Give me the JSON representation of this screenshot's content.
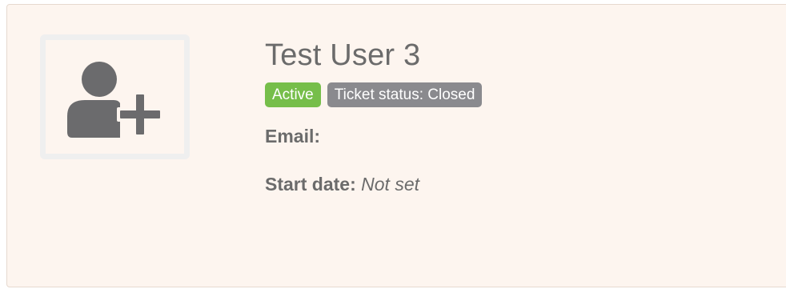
{
  "user": {
    "name": "Test User 3",
    "avatar_icon": "add-user-icon"
  },
  "badges": {
    "status": "Active",
    "ticket": "Ticket status: Closed"
  },
  "fields": {
    "email_label": "Email:",
    "email_value": "",
    "start_date_label": "Start date:",
    "start_date_value": "Not set"
  },
  "colors": {
    "card_background": "#fdf5ef",
    "active_badge": "#76be4a",
    "ticket_badge": "#8a8a8e",
    "text": "#6b6b6b"
  }
}
